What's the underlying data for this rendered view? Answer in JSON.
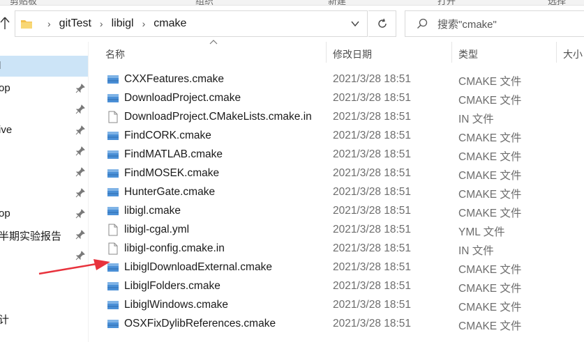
{
  "ribbon": {
    "labels": [
      "剪贴板",
      "组织",
      "新建",
      "打开",
      "选择"
    ]
  },
  "address": {
    "crumbs": [
      "gitTest",
      "libigl",
      "cmake"
    ],
    "folder_icon": "folder-icon",
    "dropdown_icon": "chevron-down-icon",
    "refresh_icon": "refresh-icon"
  },
  "search": {
    "placeholder": "搜索\"cmake\"",
    "icon": "search-icon"
  },
  "nav": {
    "items": [
      {
        "label": "l",
        "pinned": false,
        "selected": true
      },
      {
        "label": "op",
        "pinned": true
      },
      {
        "label": "",
        "pinned": true
      },
      {
        "label": "ive",
        "pinned": true
      },
      {
        "label": "",
        "pinned": true
      },
      {
        "label": "",
        "pinned": true
      },
      {
        "label": "",
        "pinned": true
      },
      {
        "label": "op",
        "pinned": true
      },
      {
        "label": "半期实验报告",
        "pinned": true
      },
      {
        "label": "",
        "pinned": true
      },
      {
        "label": "计",
        "pinned": false
      }
    ]
  },
  "columns": {
    "name": "名称",
    "date": "修改日期",
    "type": "类型",
    "size": "大小"
  },
  "files": [
    {
      "name": "CXXFeatures.cmake",
      "date": "2021/3/28 18:51",
      "type": "CMAKE 文件",
      "icon": "cmake-file-icon"
    },
    {
      "name": "DownloadProject.cmake",
      "date": "2021/3/28 18:51",
      "type": "CMAKE 文件",
      "icon": "cmake-file-icon"
    },
    {
      "name": "DownloadProject.CMakeLists.cmake.in",
      "date": "2021/3/28 18:51",
      "type": "IN 文件",
      "icon": "blank-file-icon"
    },
    {
      "name": "FindCORK.cmake",
      "date": "2021/3/28 18:51",
      "type": "CMAKE 文件",
      "icon": "cmake-file-icon"
    },
    {
      "name": "FindMATLAB.cmake",
      "date": "2021/3/28 18:51",
      "type": "CMAKE 文件",
      "icon": "cmake-file-icon"
    },
    {
      "name": "FindMOSEK.cmake",
      "date": "2021/3/28 18:51",
      "type": "CMAKE 文件",
      "icon": "cmake-file-icon"
    },
    {
      "name": "HunterGate.cmake",
      "date": "2021/3/28 18:51",
      "type": "CMAKE 文件",
      "icon": "cmake-file-icon"
    },
    {
      "name": "libigl.cmake",
      "date": "2021/3/28 18:51",
      "type": "CMAKE 文件",
      "icon": "cmake-file-icon"
    },
    {
      "name": "libigl-cgal.yml",
      "date": "2021/3/28 18:51",
      "type": "YML 文件",
      "icon": "blank-file-icon"
    },
    {
      "name": "libigl-config.cmake.in",
      "date": "2021/3/28 18:51",
      "type": "IN 文件",
      "icon": "blank-file-icon"
    },
    {
      "name": "LibiglDownloadExternal.cmake",
      "date": "2021/3/28 18:51",
      "type": "CMAKE 文件",
      "icon": "cmake-file-icon"
    },
    {
      "name": "LibiglFolders.cmake",
      "date": "2021/3/28 18:51",
      "type": "CMAKE 文件",
      "icon": "cmake-file-icon"
    },
    {
      "name": "LibiglWindows.cmake",
      "date": "2021/3/28 18:51",
      "type": "CMAKE 文件",
      "icon": "cmake-file-icon"
    },
    {
      "name": "OSXFixDylibReferences.cmake",
      "date": "2021/3/28 18:51",
      "type": "CMAKE 文件",
      "icon": "cmake-file-icon"
    }
  ],
  "annotation": {
    "arrow_color": "#e8323c",
    "points_to": "LibiglDownloadExternal.cmake"
  },
  "colors": {
    "selection": "#cce4f7",
    "cmake_icon": "#4a8fd6",
    "folder": "#f3c04b"
  }
}
